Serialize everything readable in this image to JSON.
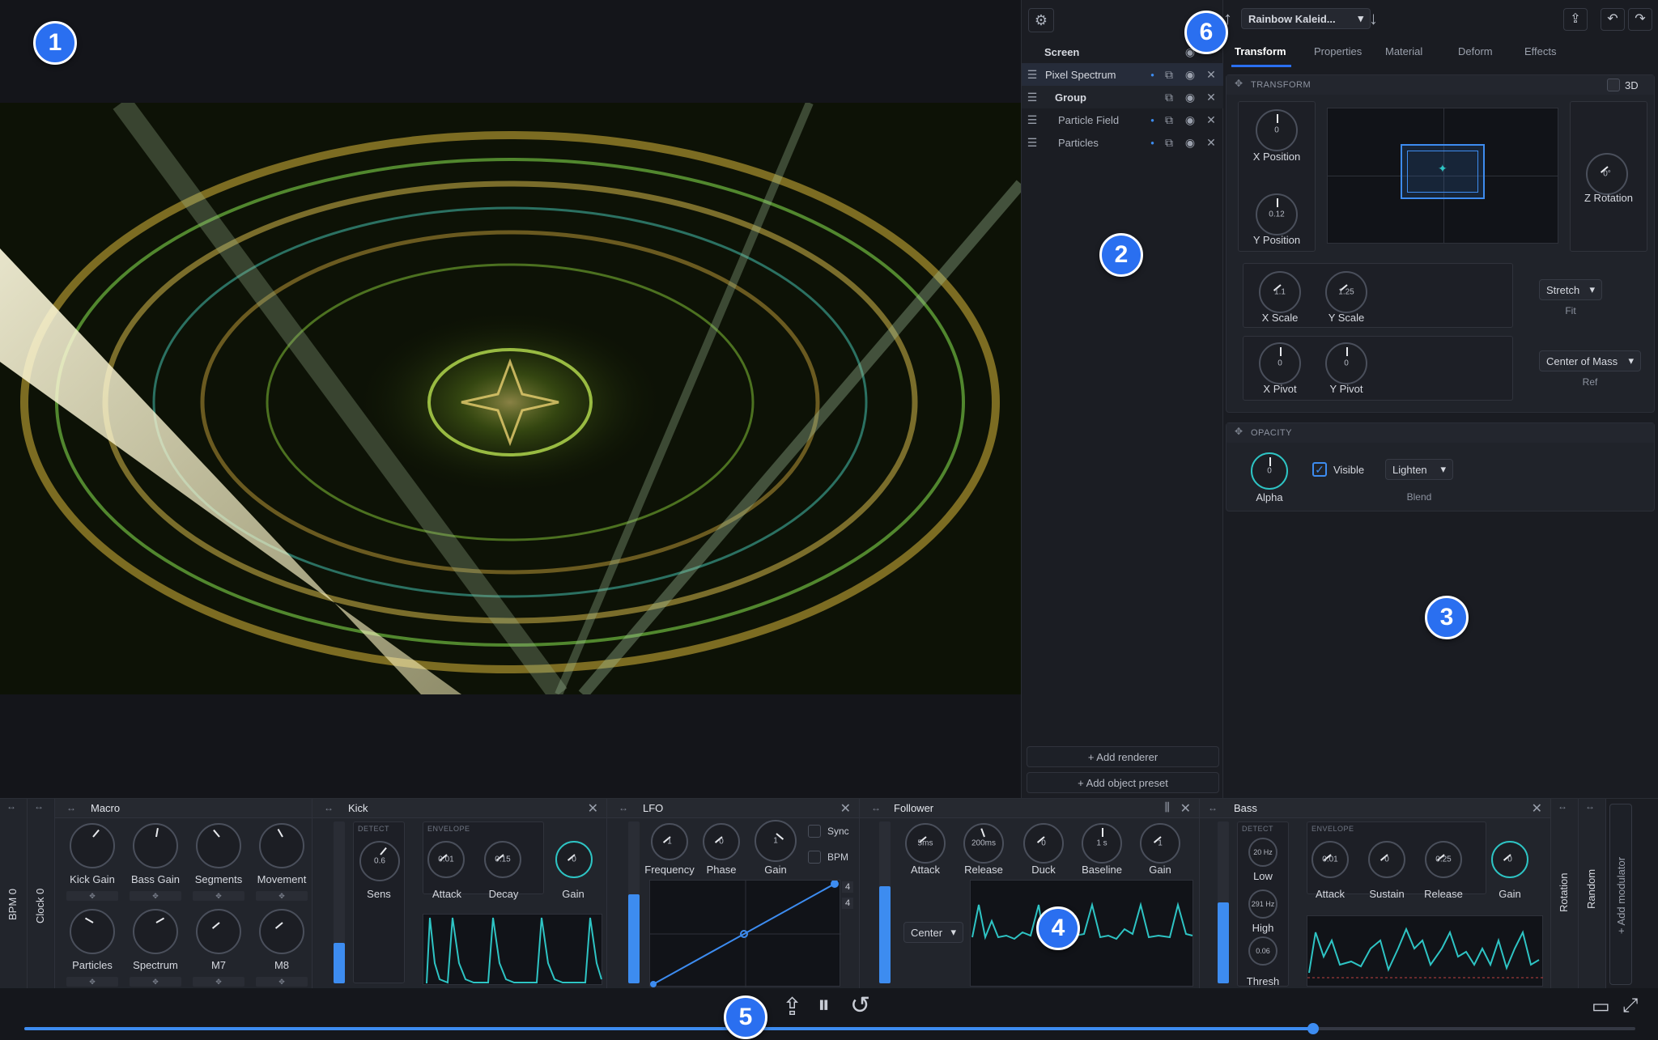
{
  "colors": {
    "accent": "#2a6ff0",
    "teal": "#2ec4c4",
    "panel": "#1b1d23",
    "meter": "#3d8cf0"
  },
  "badges": [
    "1",
    "2",
    "3",
    "4",
    "5",
    "6"
  ],
  "header": {
    "preset_name": "Rainbow Kaleid...",
    "settings_icon": "gear-icon"
  },
  "layers": {
    "screen_label": "Screen",
    "items": [
      {
        "label": "Pixel Spectrum"
      },
      {
        "label": "Group"
      },
      {
        "label": "Particle Field"
      },
      {
        "label": "Particles"
      }
    ],
    "add_renderer": "+ Add renderer",
    "add_preset": "+ Add object preset"
  },
  "tabs": [
    "Transform",
    "Properties",
    "Material",
    "Deform",
    "Effects"
  ],
  "transform": {
    "section": "TRANSFORM",
    "toggle_3d": "3D",
    "x_position": {
      "label": "X Position",
      "value": "0"
    },
    "y_position": {
      "label": "Y Position",
      "value": "0.12"
    },
    "z_rotation": {
      "label": "Z Rotation",
      "value": "0°"
    },
    "x_scale": {
      "label": "X Scale",
      "value": "1.1"
    },
    "y_scale": {
      "label": "Y Scale",
      "value": "1.25"
    },
    "fit": {
      "value": "Stretch",
      "label": "Fit"
    },
    "x_pivot": {
      "label": "X Pivot",
      "value": "0"
    },
    "y_pivot": {
      "label": "Y Pivot",
      "value": "0"
    },
    "ref": {
      "value": "Center of Mass",
      "label": "Ref"
    }
  },
  "opacity": {
    "section": "OPACITY",
    "alpha": {
      "label": "Alpha",
      "value": "0"
    },
    "visible_label": "Visible",
    "blend": {
      "value": "Lighten",
      "label": "Blend"
    }
  },
  "modules": {
    "bpm": "BPM 0",
    "clock": "Clock 0",
    "macro": {
      "title": "Macro",
      "knobs": [
        "Kick Gain",
        "Bass Gain",
        "Segments",
        "Movement",
        "Particles",
        "Spectrum",
        "M7",
        "M8"
      ]
    },
    "kick": {
      "title": "Kick",
      "detect": "DETECT",
      "envelope": "ENVELOPE",
      "sens": {
        "label": "Sens",
        "value": "0.6"
      },
      "attack": {
        "label": "Attack",
        "value": "0.01"
      },
      "decay": {
        "label": "Decay",
        "value": "0.15"
      },
      "gain": {
        "label": "Gain",
        "value": "0"
      },
      "meter_level": 0.25
    },
    "lfo": {
      "title": "LFO",
      "frequency": {
        "label": "Frequency",
        "value": "1"
      },
      "phase": {
        "label": "Phase",
        "value": "0"
      },
      "gain": {
        "label": "Gain",
        "value": "1"
      },
      "sync": "Sync",
      "bpm": "BPM",
      "steps_top": "4",
      "steps_bottom": "4",
      "meter_level": 0.55
    },
    "follower": {
      "title": "Follower",
      "attack": {
        "label": "Attack",
        "value": "5ms"
      },
      "release": {
        "label": "Release",
        "value": "200ms"
      },
      "duck": {
        "label": "Duck",
        "value": "0"
      },
      "baseline": {
        "label": "Baseline",
        "value": "1 s"
      },
      "gain": {
        "label": "Gain",
        "value": "1"
      },
      "mode": "Center",
      "meter_level": 0.6
    },
    "bass": {
      "title": "Bass",
      "detect": "DETECT",
      "envelope": "ENVELOPE",
      "low": {
        "label": "Low",
        "value": "20 Hz"
      },
      "high": {
        "label": "High",
        "value": "291 Hz"
      },
      "thresh": {
        "label": "Thresh",
        "value": "0.06"
      },
      "attack": {
        "label": "Attack",
        "value": "0.01"
      },
      "sustain": {
        "label": "Sustain",
        "value": "0"
      },
      "release": {
        "label": "Release",
        "value": "0.25"
      },
      "gain": {
        "label": "Gain",
        "value": "0"
      },
      "meter_level": 0.5
    },
    "rotation": "Rotation",
    "random": "Random",
    "add_modulator": "+ Add modulator"
  },
  "transport": {
    "progress": 0.8
  }
}
